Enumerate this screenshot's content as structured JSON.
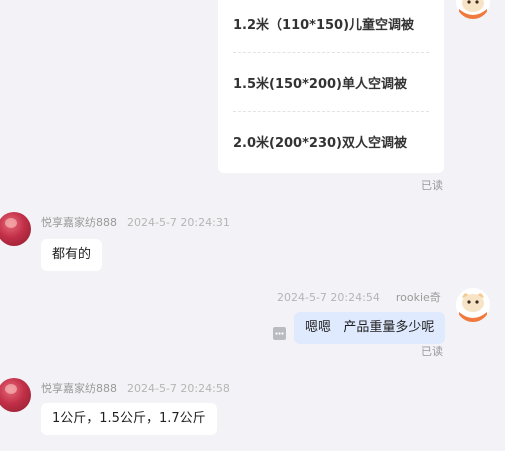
{
  "messages": {
    "options_card": {
      "items": [
        "1.2米（110*150)儿童空调被",
        "1.5米(150*200)单人空调被",
        "2.0米(200*230)双人空调被"
      ],
      "status": "已读"
    },
    "seller_msg_1": {
      "sender": "悦享嘉家纺888",
      "time": "2024-5-7 20:24:31",
      "text": "都有的"
    },
    "user_msg_1": {
      "time": "2024-5-7 20:24:54",
      "sender": "rookie奇",
      "text": "嗯嗯   产品重量多少呢",
      "status": "已读"
    },
    "seller_msg_2": {
      "sender": "悦享嘉家纺888",
      "time": "2024-5-7 20:24:58",
      "text": "1公斤，1.5公斤，1.7公斤"
    }
  },
  "colors": {
    "background": "#f3f3f7",
    "bubble_mine": "#dfeafe",
    "bubble_other": "#ffffff",
    "meta_text": "#9a9a9a"
  }
}
